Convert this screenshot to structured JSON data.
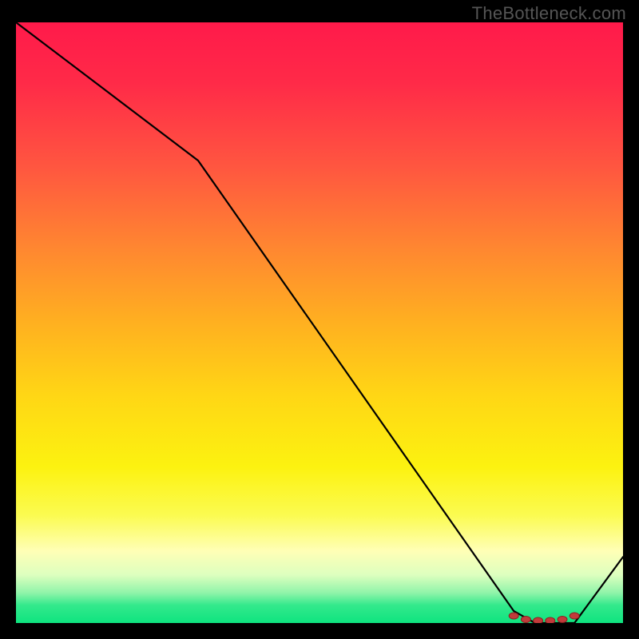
{
  "attribution": "TheBottleneck.com",
  "chart_data": {
    "type": "line",
    "title": "",
    "xlabel": "",
    "ylabel": "",
    "xlim": [
      0,
      100
    ],
    "ylim": [
      0,
      100
    ],
    "x": [
      0,
      30,
      82,
      85.5,
      88,
      92,
      100
    ],
    "values": [
      100,
      77,
      2,
      0,
      0,
      0,
      11
    ],
    "markers": {
      "x": [
        82,
        84,
        86,
        88,
        90,
        92
      ],
      "values": [
        1.2,
        0.6,
        0.4,
        0.4,
        0.6,
        1.2
      ]
    },
    "series": [
      {
        "name": "curve",
        "x": [
          0,
          30,
          82,
          85.5,
          88,
          92,
          100
        ],
        "values": [
          100,
          77,
          2,
          0,
          0,
          0,
          11
        ]
      }
    ],
    "colors": {
      "line": "#000000",
      "marker": "#c23b3b",
      "marker_border": "#8a2020"
    }
  }
}
